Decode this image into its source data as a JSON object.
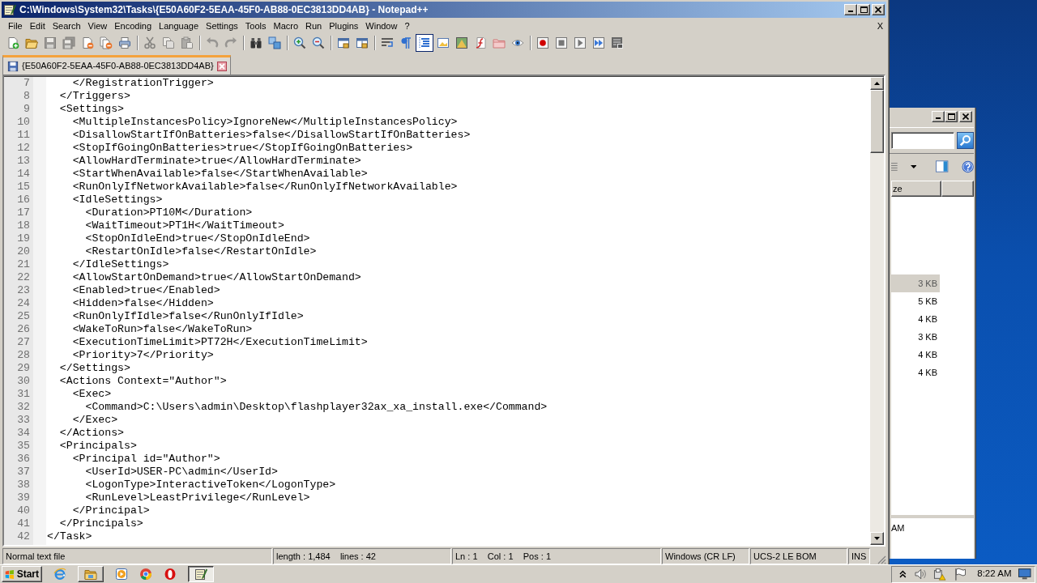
{
  "window": {
    "title": "C:\\Windows\\System32\\Tasks\\{E50A60F2-5EAA-45F0-AB88-0EC3813DD4AB} - Notepad++"
  },
  "menu": [
    "File",
    "Edit",
    "Search",
    "View",
    "Encoding",
    "Language",
    "Settings",
    "Tools",
    "Macro",
    "Run",
    "Plugins",
    "Window",
    "?"
  ],
  "menu_close": "X",
  "toolbar": [
    [
      {
        "kind": "new",
        "pressed": false,
        "disabled": false
      },
      {
        "kind": "open",
        "pressed": false,
        "disabled": false
      },
      {
        "kind": "save",
        "pressed": false,
        "disabled": true
      },
      {
        "kind": "save_all",
        "pressed": false,
        "disabled": true
      },
      {
        "kind": "close",
        "pressed": false,
        "disabled": false
      },
      {
        "kind": "close_all",
        "pressed": false,
        "disabled": false
      },
      {
        "kind": "print",
        "pressed": false,
        "disabled": false
      }
    ],
    [
      {
        "kind": "cut",
        "pressed": false,
        "disabled": true
      },
      {
        "kind": "copy",
        "pressed": false,
        "disabled": true
      },
      {
        "kind": "paste",
        "pressed": false,
        "disabled": true
      }
    ],
    [
      {
        "kind": "undo",
        "pressed": false,
        "disabled": true
      },
      {
        "kind": "redo",
        "pressed": false,
        "disabled": true
      }
    ],
    [
      {
        "kind": "find",
        "pressed": false,
        "disabled": false
      },
      {
        "kind": "replace",
        "pressed": false,
        "disabled": false
      }
    ],
    [
      {
        "kind": "zoom_in",
        "pressed": false,
        "disabled": false
      },
      {
        "kind": "zoom_out",
        "pressed": false,
        "disabled": false
      }
    ],
    [
      {
        "kind": "sync_v",
        "pressed": false,
        "disabled": false
      },
      {
        "kind": "sync_h",
        "pressed": false,
        "disabled": false
      }
    ],
    [
      {
        "kind": "wrap",
        "pressed": false,
        "disabled": false
      },
      {
        "kind": "all_chars",
        "pressed": false,
        "disabled": false
      },
      {
        "kind": "indent_guide",
        "pressed": true,
        "disabled": false
      },
      {
        "kind": "user_lang",
        "pressed": false,
        "disabled": false
      },
      {
        "kind": "doc_map",
        "pressed": false,
        "disabled": false
      },
      {
        "kind": "func_list",
        "pressed": false,
        "disabled": false
      },
      {
        "kind": "workspace",
        "pressed": false,
        "disabled": false
      },
      {
        "kind": "monitor",
        "pressed": false,
        "disabled": false
      }
    ],
    [
      {
        "kind": "rec",
        "pressed": false,
        "disabled": false
      },
      {
        "kind": "stop",
        "pressed": false,
        "disabled": false
      },
      {
        "kind": "play",
        "pressed": false,
        "disabled": false
      },
      {
        "kind": "play_multi",
        "pressed": false,
        "disabled": false
      },
      {
        "kind": "save_macro",
        "pressed": false,
        "disabled": false
      }
    ]
  ],
  "tabs": [
    {
      "label": "{E50A60F2-5EAA-45F0-AB88-0EC3813DD4AB}",
      "selected": true,
      "modified": false
    }
  ],
  "editor": {
    "lines": [
      {
        "number": "7",
        "text": "    </RegistrationTrigger>"
      },
      {
        "number": "8",
        "text": "  </Triggers>"
      },
      {
        "number": "9",
        "text": "  <Settings>"
      },
      {
        "number": "10",
        "text": "    <MultipleInstancesPolicy>IgnoreNew</MultipleInstancesPolicy>"
      },
      {
        "number": "11",
        "text": "    <DisallowStartIfOnBatteries>false</DisallowStartIfOnBatteries>"
      },
      {
        "number": "12",
        "text": "    <StopIfGoingOnBatteries>true</StopIfGoingOnBatteries>"
      },
      {
        "number": "13",
        "text": "    <AllowHardTerminate>true</AllowHardTerminate>"
      },
      {
        "number": "14",
        "text": "    <StartWhenAvailable>false</StartWhenAvailable>"
      },
      {
        "number": "15",
        "text": "    <RunOnlyIfNetworkAvailable>false</RunOnlyIfNetworkAvailable>"
      },
      {
        "number": "16",
        "text": "    <IdleSettings>"
      },
      {
        "number": "17",
        "text": "      <Duration>PT10M</Duration>"
      },
      {
        "number": "18",
        "text": "      <WaitTimeout>PT1H</WaitTimeout>"
      },
      {
        "number": "19",
        "text": "      <StopOnIdleEnd>true</StopOnIdleEnd>"
      },
      {
        "number": "20",
        "text": "      <RestartOnIdle>false</RestartOnIdle>"
      },
      {
        "number": "21",
        "text": "    </IdleSettings>"
      },
      {
        "number": "22",
        "text": "    <AllowStartOnDemand>true</AllowStartOnDemand>"
      },
      {
        "number": "23",
        "text": "    <Enabled>true</Enabled>"
      },
      {
        "number": "24",
        "text": "    <Hidden>false</Hidden>"
      },
      {
        "number": "25",
        "text": "    <RunOnlyIfIdle>false</RunOnlyIfIdle>"
      },
      {
        "number": "26",
        "text": "    <WakeToRun>false</WakeToRun>"
      },
      {
        "number": "27",
        "text": "    <ExecutionTimeLimit>PT72H</ExecutionTimeLimit>"
      },
      {
        "number": "28",
        "text": "    <Priority>7</Priority>"
      },
      {
        "number": "29",
        "text": "  </Settings>"
      },
      {
        "number": "30",
        "text": "  <Actions Context=\"Author\">"
      },
      {
        "number": "31",
        "text": "    <Exec>"
      },
      {
        "number": "32",
        "text": "      <Command>C:\\Users\\admin\\Desktop\\flashplayer32ax_xa_install.exe</Command>"
      },
      {
        "number": "33",
        "text": "    </Exec>"
      },
      {
        "number": "34",
        "text": "  </Actions>"
      },
      {
        "number": "35",
        "text": "  <Principals>"
      },
      {
        "number": "36",
        "text": "    <Principal id=\"Author\">"
      },
      {
        "number": "37",
        "text": "      <UserId>USER-PC\\admin</UserId>"
      },
      {
        "number": "38",
        "text": "      <LogonType>InteractiveToken</LogonType>"
      },
      {
        "number": "39",
        "text": "      <RunLevel>LeastPrivilege</RunLevel>"
      },
      {
        "number": "40",
        "text": "    </Principal>"
      },
      {
        "number": "41",
        "text": "  </Principals>"
      },
      {
        "number": "42",
        "text": "</Task>"
      }
    ]
  },
  "status_bar": [
    "Normal text file",
    "length : 1,484    lines : 42",
    "Ln : 1    Col : 1    Pos : 1",
    "Windows (CR LF)",
    "UCS-2 LE BOM",
    "INS"
  ],
  "explorer_window": {
    "column_header": "ze",
    "rows": [
      {
        "size": "3 KB",
        "selected": true
      },
      {
        "size": "5 KB",
        "selected": false
      },
      {
        "size": "4 KB",
        "selected": false
      },
      {
        "size": "3 KB",
        "selected": false
      },
      {
        "size": "4 KB",
        "selected": false
      },
      {
        "size": "4 KB",
        "selected": false
      }
    ],
    "details": "AM"
  },
  "taskbar": {
    "start": "Start",
    "apps": [
      {
        "kind": "ie",
        "running": false,
        "active": false
      },
      {
        "kind": "explorer",
        "running": true,
        "active": false
      },
      {
        "kind": "media",
        "running": false,
        "active": false
      },
      {
        "kind": "chrome",
        "running": false,
        "active": false
      },
      {
        "kind": "opera",
        "running": false,
        "active": false
      },
      {
        "kind": "notepad",
        "running": true,
        "active": true
      }
    ],
    "clock": "8:22 AM"
  }
}
